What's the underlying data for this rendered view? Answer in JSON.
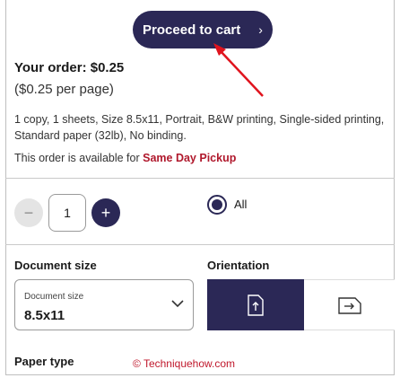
{
  "header": {
    "proceed_label": "Proceed to cart",
    "proceed_chevron": "›"
  },
  "order": {
    "total": "Your order: $0.25",
    "per_page": "($0.25 per page)",
    "details": "1 copy,  1 sheets,  Size 8.5x11,  Portrait,  B&W printing,  Single-sided printing,  Standard paper (32lb), No binding.",
    "availability_prefix": "This order is available for ",
    "availability_highlight": "Same Day Pickup"
  },
  "quantity": {
    "minus": "−",
    "value": "1",
    "plus": "+"
  },
  "pages": {
    "all_label": "All"
  },
  "document_size": {
    "section_label": "Document size",
    "field_label": "Document size",
    "value": "8.5x11"
  },
  "orientation": {
    "section_label": "Orientation",
    "selected": "portrait"
  },
  "paper_type": {
    "section_label": "Paper type"
  },
  "watermark": "© Techniquehow.com",
  "colors": {
    "brand": "#2b2856",
    "highlight": "#b0182c",
    "annotation": "#e0141e"
  }
}
